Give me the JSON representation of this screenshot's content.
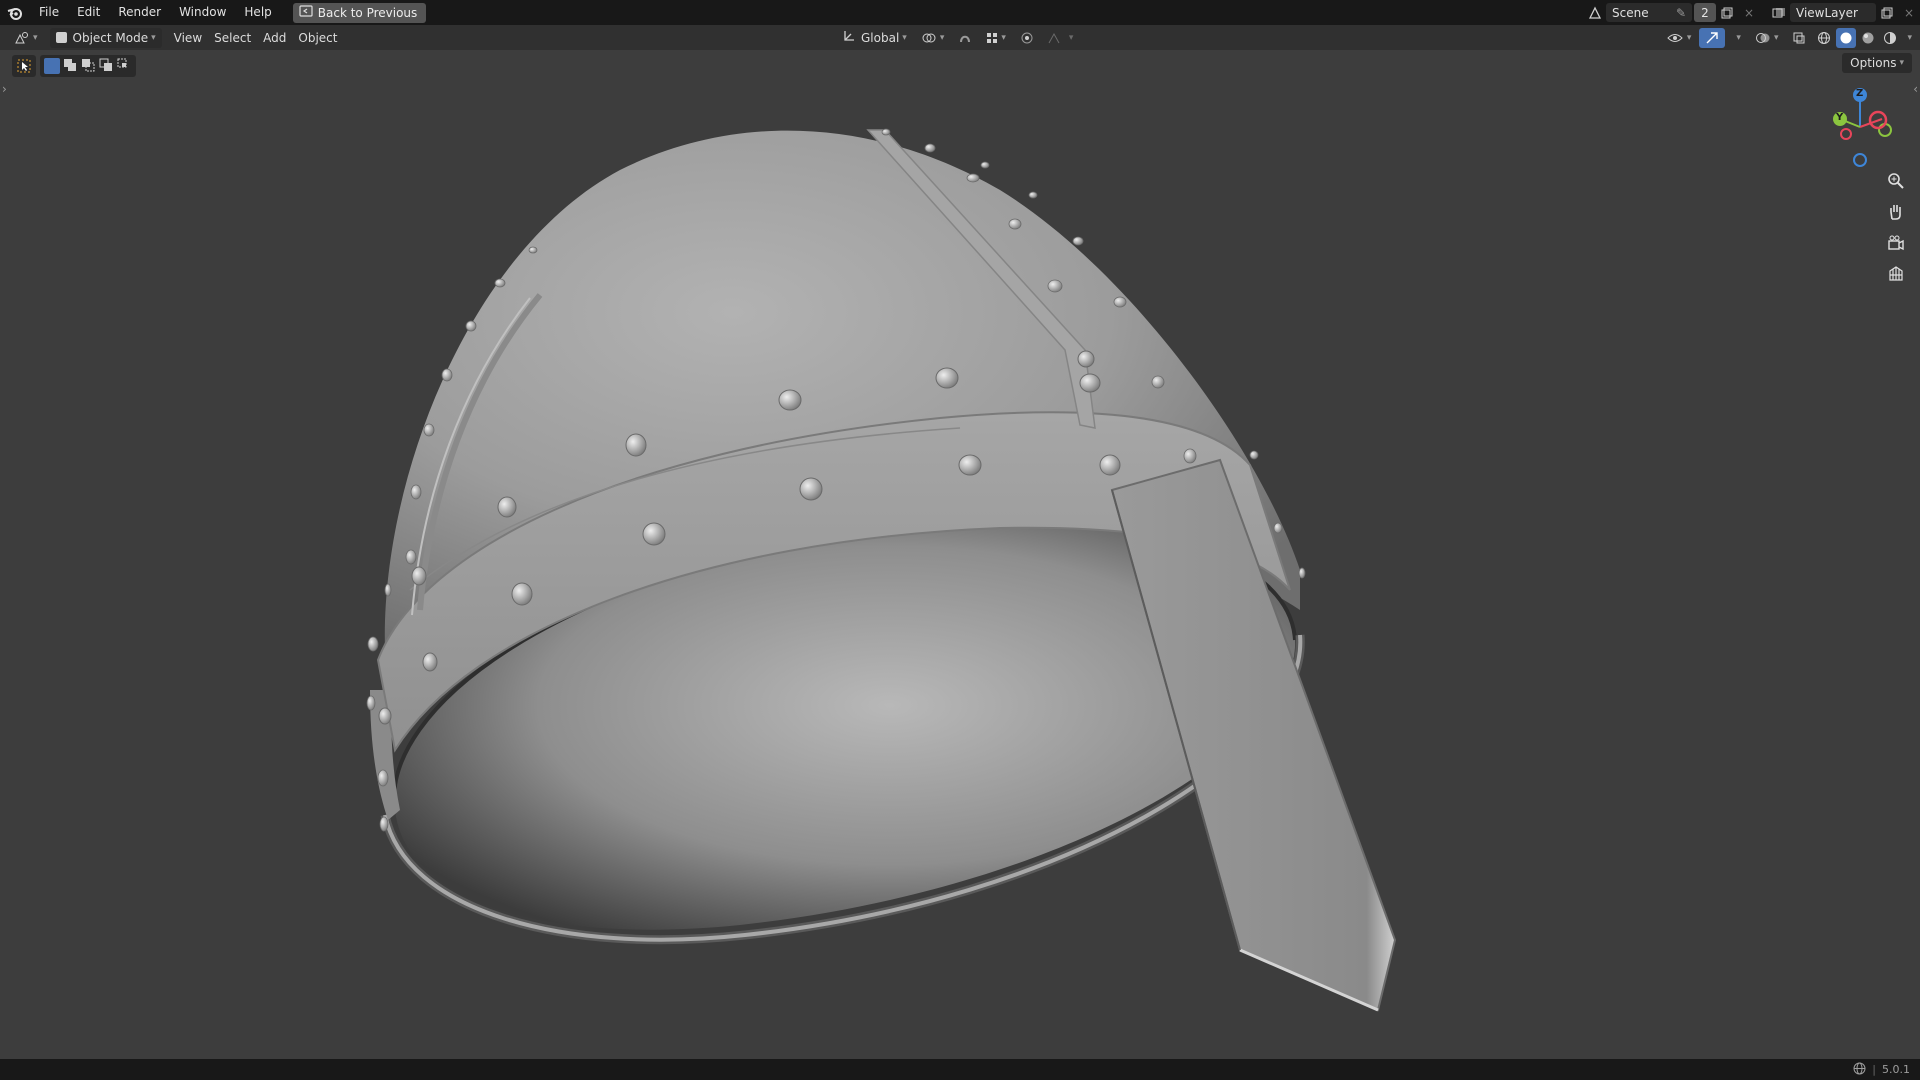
{
  "topbar": {
    "menus": [
      "File",
      "Edit",
      "Render",
      "Window",
      "Help"
    ],
    "back_button": "Back to Previous",
    "scene_name": "Scene",
    "scene_users": "2",
    "view_layer": "ViewLayer"
  },
  "header": {
    "mode": "Object Mode",
    "menus": [
      "View",
      "Select",
      "Add",
      "Object"
    ],
    "orientation": "Global"
  },
  "viewport": {
    "options_label": "Options",
    "gizmo_axes": {
      "z": "Z",
      "y": "Y"
    }
  },
  "statusbar": {
    "version": "5.0.1"
  },
  "colors": {
    "axis_x": "#e8455a",
    "axis_y": "#8bc53f",
    "axis_z": "#3e86d8",
    "accent": "#4772b3"
  },
  "icons": [
    "blender-logo-icon",
    "editor-type-icon",
    "object-mode-icon",
    "transform-orientation-icon",
    "pivot-icon",
    "snap-icon",
    "proportional-edit-icon",
    "visibility-icon",
    "gizmo-icon",
    "overlay-icon",
    "xray-icon",
    "shading-wireframe-icon",
    "shading-solid-icon",
    "shading-material-icon",
    "shading-rendered-icon",
    "zoom-icon",
    "pan-hand-icon",
    "camera-view-icon",
    "ortho-grid-icon",
    "globe-icon"
  ]
}
